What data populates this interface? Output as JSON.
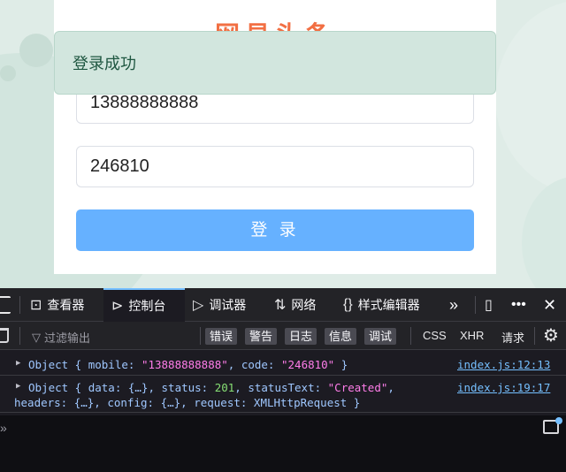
{
  "page": {
    "title_partial": "网易头条",
    "mobile_value": "13888888888",
    "code_value": "246810",
    "login_button": "登 录",
    "toast_message": "登录成功"
  },
  "devtools": {
    "tabs": [
      {
        "label": "查看器",
        "icon": "inspector-icon"
      },
      {
        "label": "控制台",
        "icon": "console-icon"
      },
      {
        "label": "调试器",
        "icon": "debugger-icon"
      },
      {
        "label": "网络",
        "icon": "network-icon"
      },
      {
        "label": "样式编辑器",
        "icon": "style-editor-icon"
      }
    ],
    "active_tab": "控制台",
    "filter_placeholder": "过滤输出",
    "levels": [
      "错误",
      "警告",
      "日志",
      "信息",
      "调试"
    ],
    "toggles": [
      "CSS",
      "XHR",
      "请求"
    ],
    "logs": [
      {
        "source": "index.js:12:13"
      },
      {
        "source": "index.js:19:17"
      }
    ]
  },
  "colors": {
    "accent": "#66b1ff",
    "title": "#f26f43",
    "toast_bg": "#d2e6de",
    "devtools_bg": "#1c1b22"
  }
}
